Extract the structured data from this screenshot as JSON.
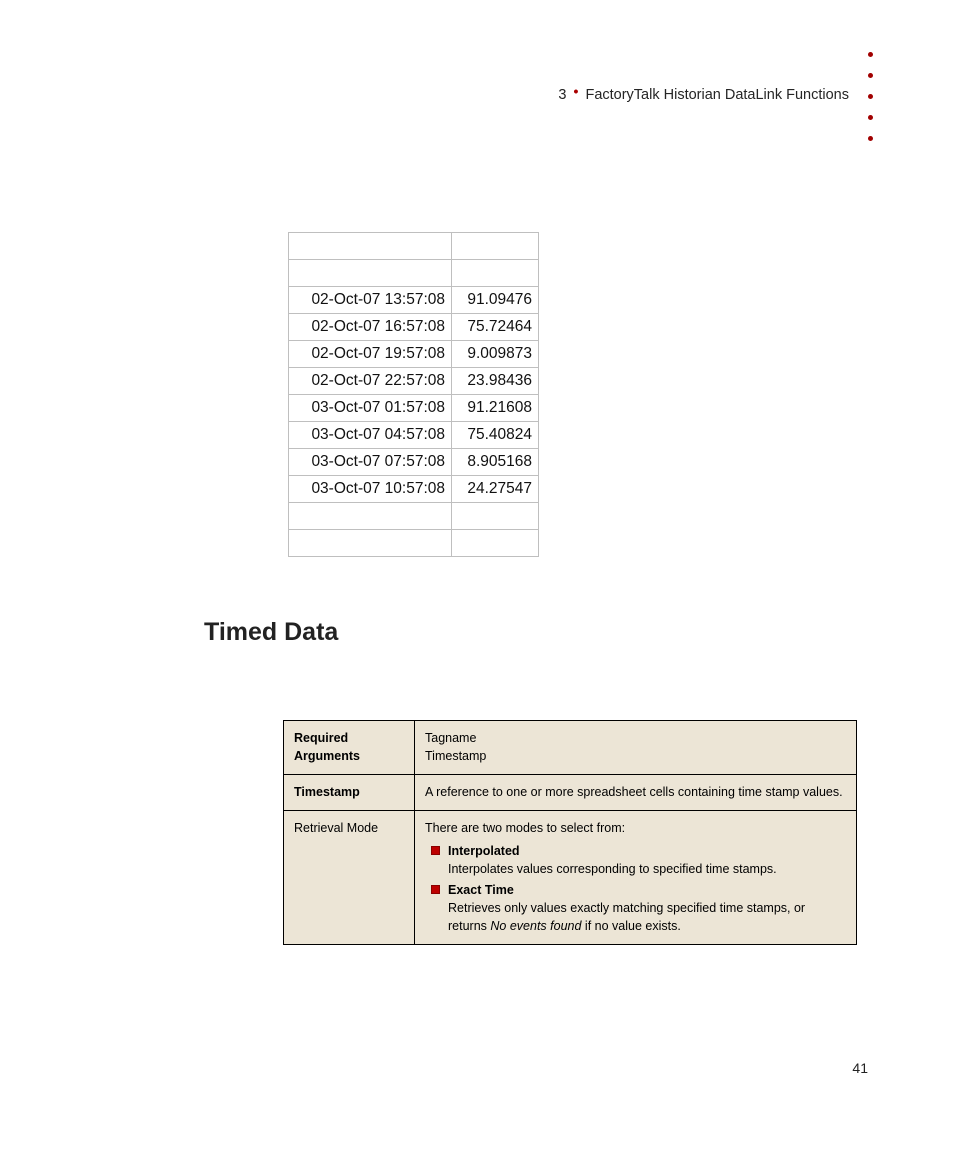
{
  "header": {
    "chapter_num": "3",
    "chapter_title": "FactoryTalk Historian DataLink Functions"
  },
  "data_rows": [
    {
      "ts": "02-Oct-07 13:57:08",
      "val": "91.09476"
    },
    {
      "ts": "02-Oct-07 16:57:08",
      "val": "75.72464"
    },
    {
      "ts": "02-Oct-07 19:57:08",
      "val": "9.009873"
    },
    {
      "ts": "02-Oct-07 22:57:08",
      "val": "23.98436"
    },
    {
      "ts": "03-Oct-07 01:57:08",
      "val": "91.21608"
    },
    {
      "ts": "03-Oct-07 04:57:08",
      "val": "75.40824"
    },
    {
      "ts": "03-Oct-07 07:57:08",
      "val": "8.905168"
    },
    {
      "ts": "03-Oct-07 10:57:08",
      "val": "24.27547"
    }
  ],
  "section_heading": "Timed Data",
  "args_table": {
    "row1_label": "Required Arguments",
    "row1_val_line1": "Tagname",
    "row1_val_line2": "Timestamp",
    "row2_label": "Timestamp",
    "row2_val": "A reference to one or more spreadsheet cells containing time stamp values.",
    "row3_label": "Retrieval Mode",
    "row3_intro": "There are two modes to select from:",
    "row3_mode1_name": "Interpolated",
    "row3_mode1_desc": "Interpolates values corresponding to specified time stamps.",
    "row3_mode2_name": "Exact Time",
    "row3_mode2_desc_a": "Retrieves only values exactly matching specified time stamps, or returns ",
    "row3_mode2_desc_b": "No events found",
    "row3_mode2_desc_c": " if no value exists."
  },
  "page_number": "41"
}
